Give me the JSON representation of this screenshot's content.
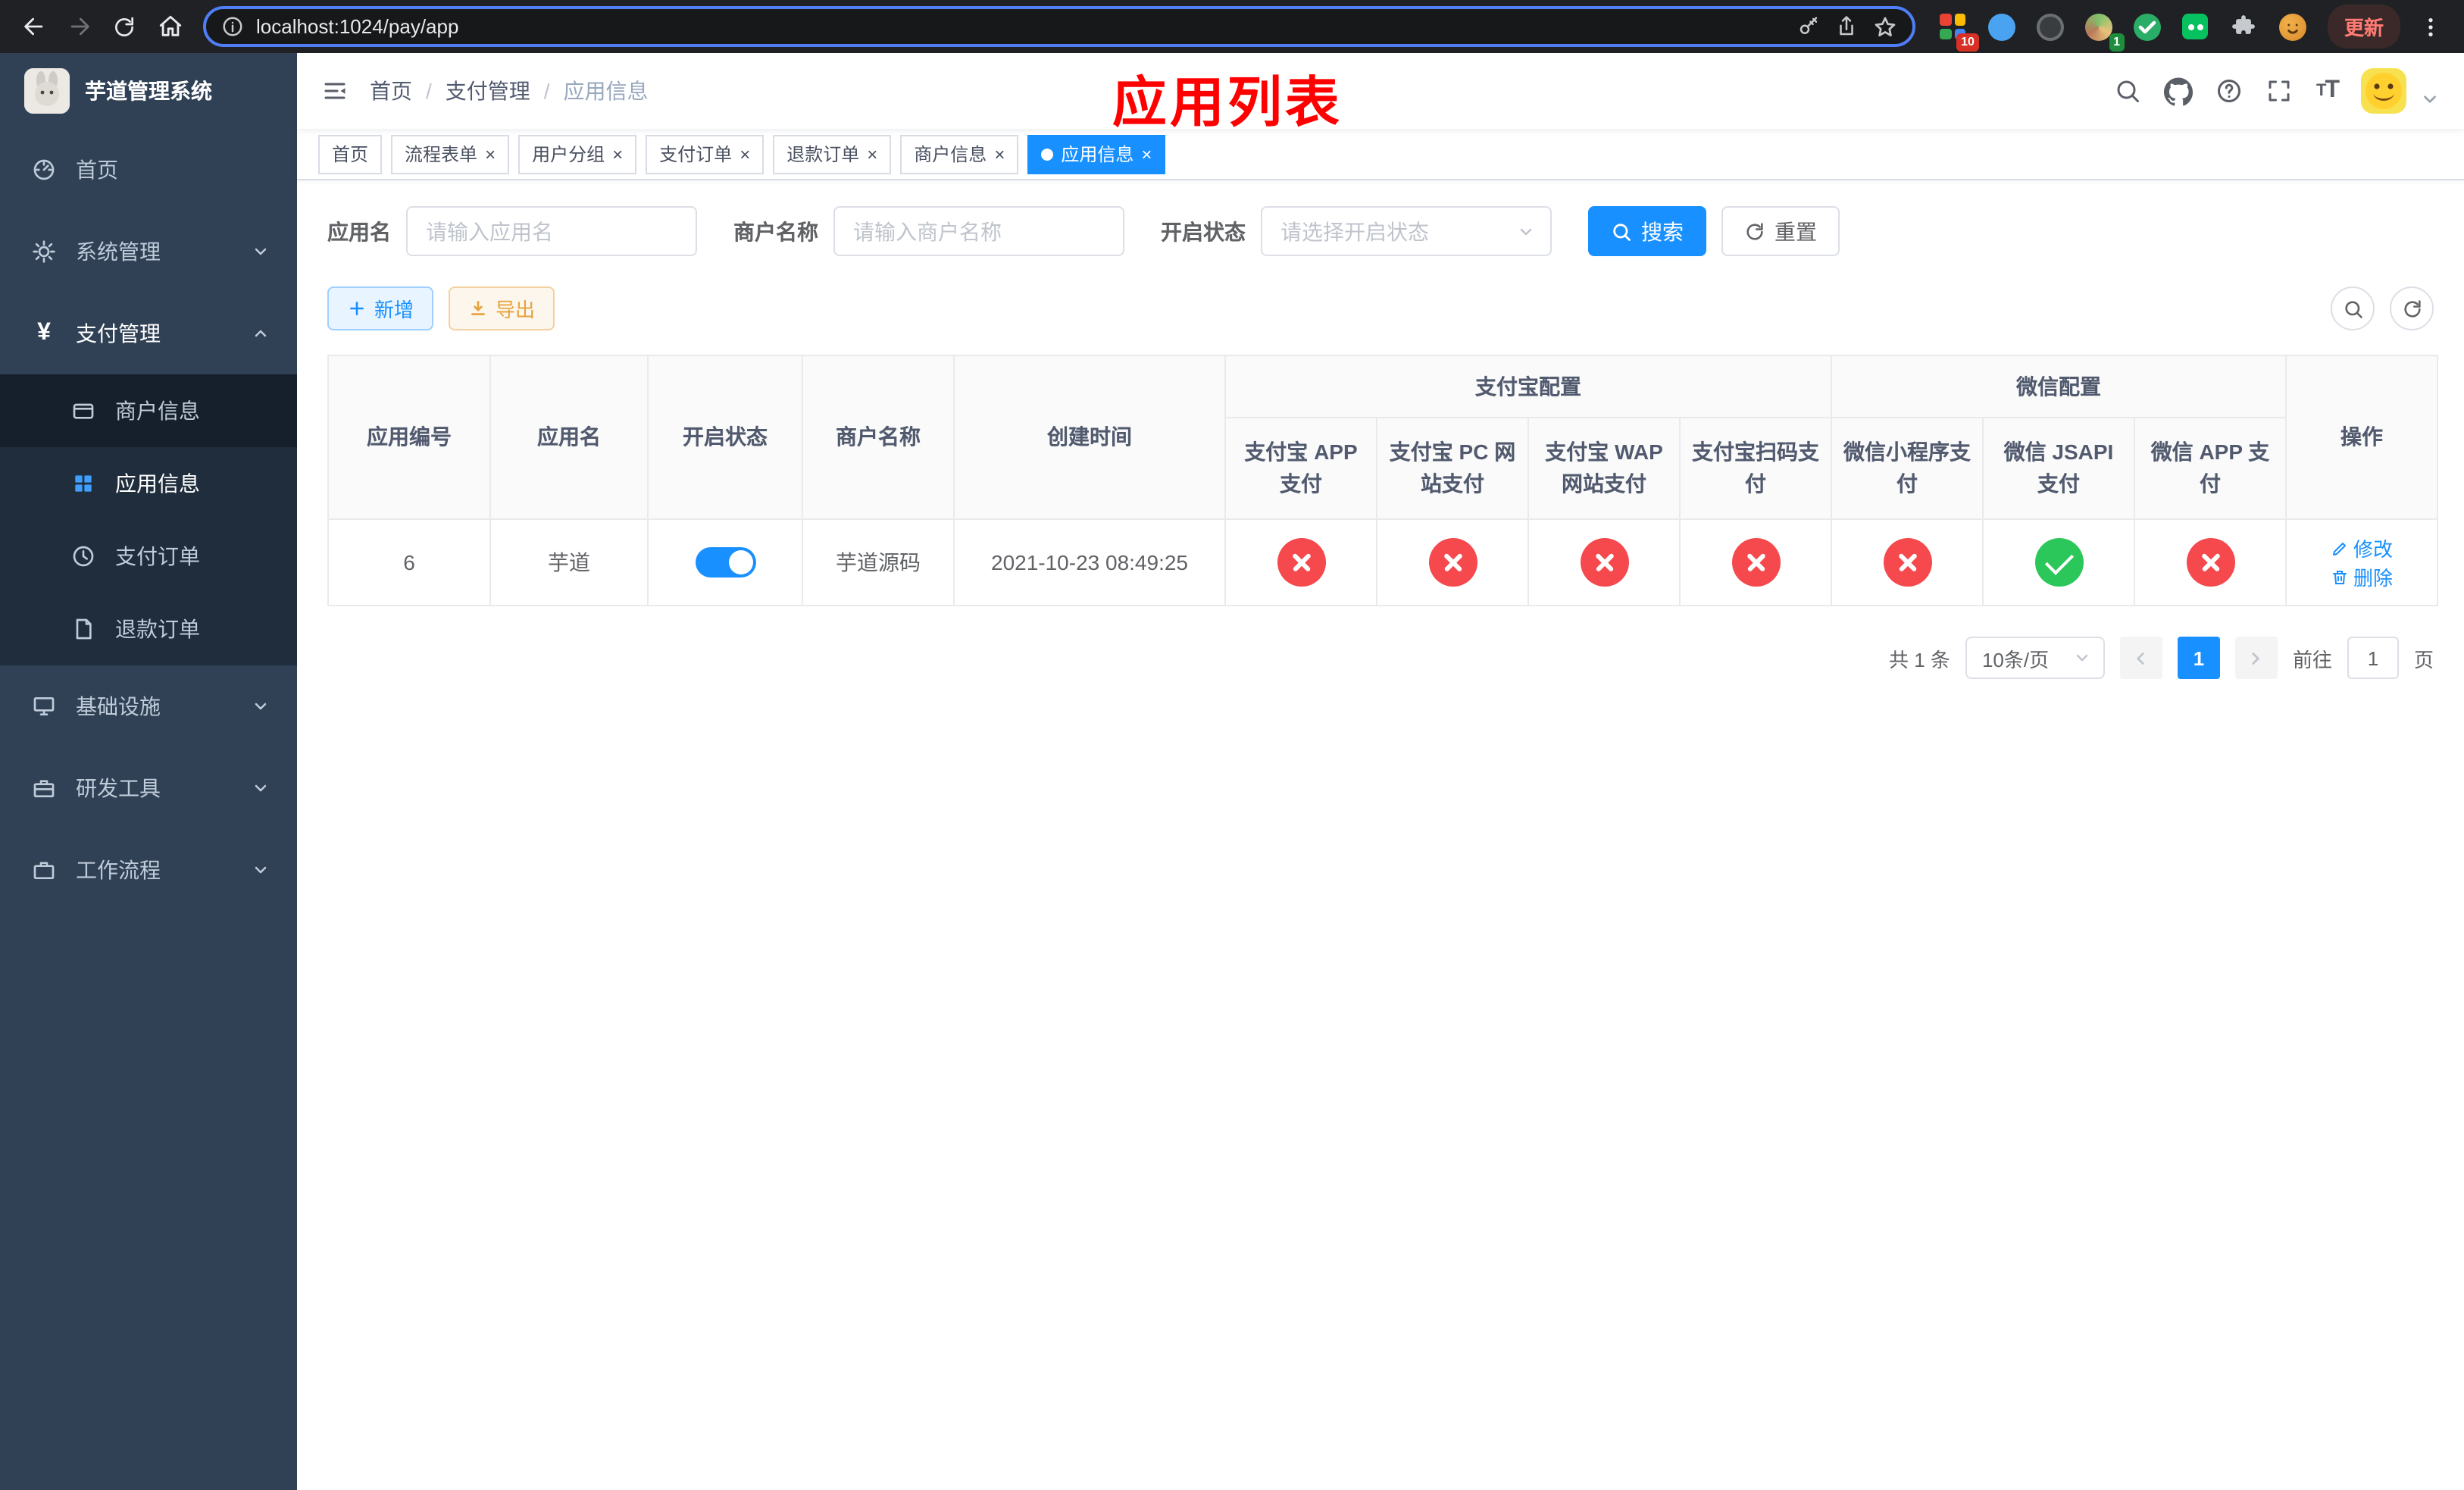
{
  "colors": {
    "accent": "#1890ff",
    "danger": "#f5494d",
    "success": "#2bc75a",
    "warning": "#e6a23c",
    "annotation": "#ff0000"
  },
  "browser": {
    "url": "localhost:1024/pay/app",
    "update_button": "更新",
    "ext_badge_a": "10",
    "ext_badge_b": "1"
  },
  "sidebar": {
    "title": "芋道管理系统",
    "menu": [
      {
        "label": "首页"
      },
      {
        "label": "系统管理"
      },
      {
        "label": "支付管理"
      },
      {
        "label": "基础设施"
      },
      {
        "label": "研发工具"
      },
      {
        "label": "工作流程"
      }
    ],
    "submenu": [
      {
        "label": "商户信息"
      },
      {
        "label": "应用信息"
      },
      {
        "label": "支付订单"
      },
      {
        "label": "退款订单"
      }
    ]
  },
  "header": {
    "breadcrumb": [
      "首页",
      "支付管理",
      "应用信息"
    ],
    "annotation": "应用列表"
  },
  "tabs": [
    {
      "label": "首页"
    },
    {
      "label": "流程表单"
    },
    {
      "label": "用户分组"
    },
    {
      "label": "支付订单"
    },
    {
      "label": "退款订单"
    },
    {
      "label": "商户信息"
    },
    {
      "label": "应用信息"
    }
  ],
  "filter": {
    "app_name_label": "应用名",
    "app_name_placeholder": "请输入应用名",
    "merchant_label": "商户名称",
    "merchant_placeholder": "请输入商户名称",
    "status_label": "开启状态",
    "status_placeholder": "请选择开启状态",
    "search_label": "搜索",
    "reset_label": "重置"
  },
  "toolbar": {
    "add_label": "新增",
    "export_label": "导出"
  },
  "table": {
    "groups": {
      "alipay": "支付宝配置",
      "wechat": "微信配置"
    },
    "columns": [
      "应用编号",
      "应用名",
      "开启状态",
      "商户名称",
      "创建时间",
      "支付宝 APP 支付",
      "支付宝 PC 网站支付",
      "支付宝 WAP 网站支付",
      "支付宝扫码支付",
      "微信小程序支付",
      "微信 JSAPI 支付",
      "微信 APP 支付",
      "操作"
    ],
    "row": {
      "id": "6",
      "name": "芋道",
      "enabled": true,
      "merchant": "芋道源码",
      "created": "2021-10-23 08:49:25",
      "channels": [
        "disabled",
        "disabled",
        "disabled",
        "disabled",
        "disabled",
        "enabled",
        "disabled"
      ],
      "edit_label": "修改",
      "delete_label": "删除"
    }
  },
  "pagination": {
    "total_text": "共 1 条",
    "page_size": "10条/页",
    "current_page": "1",
    "goto_label": "前往",
    "goto_value": "1",
    "goto_unit": "页"
  }
}
